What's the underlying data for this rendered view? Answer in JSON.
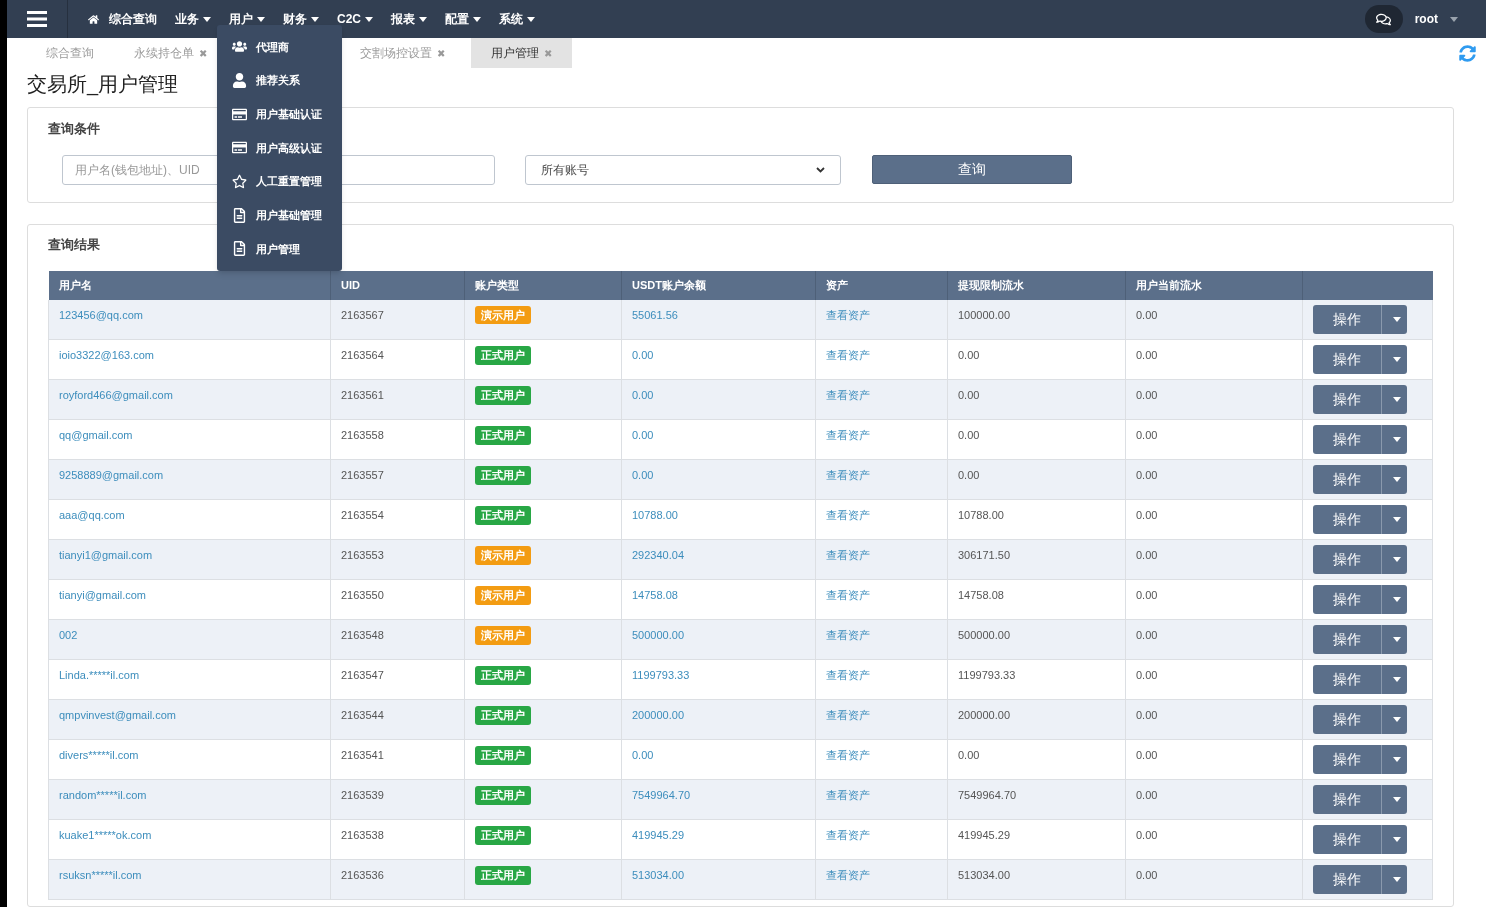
{
  "navbar": {
    "items": [
      {
        "label": "综合查询",
        "kind": "home"
      },
      {
        "label": "业务",
        "kind": "menu"
      },
      {
        "label": "用户",
        "kind": "menu"
      },
      {
        "label": "财务",
        "kind": "menu"
      },
      {
        "label": "C2C",
        "kind": "menu"
      },
      {
        "label": "报表",
        "kind": "menu"
      },
      {
        "label": "配置",
        "kind": "menu"
      },
      {
        "label": "系统",
        "kind": "menu"
      }
    ],
    "user": "root"
  },
  "dropdown": [
    {
      "label": "代理商",
      "kind": "group"
    },
    {
      "label": "推荐关系",
      "kind": "person"
    },
    {
      "label": "用户基础认证",
      "kind": "card"
    },
    {
      "label": "用户高级认证",
      "kind": "card"
    },
    {
      "label": "人工重置管理",
      "kind": "star"
    },
    {
      "label": "用户基础管理",
      "kind": "document"
    },
    {
      "label": "用户管理",
      "kind": "document"
    }
  ],
  "tabs": [
    {
      "label": "综合查询",
      "closable": false,
      "selected": false
    },
    {
      "label": "永续持仓单",
      "closable": true,
      "selected": false
    },
    {
      "label": "交割场控设置",
      "closable": true,
      "selected": false
    },
    {
      "label": "用户管理",
      "closable": true,
      "selected": true
    }
  ],
  "close_glyph": "✖",
  "page_title": "交易所_用户管理",
  "query_panel": {
    "title": "查询条件",
    "search": {
      "placeholder": "用户名(钱包地址)、UID"
    },
    "account_select": "所有账号",
    "button": "查询"
  },
  "results_panel": {
    "title": "查询结果"
  },
  "table": {
    "columns": [
      "用户名",
      "UID",
      "账户类型",
      "USDT账户余额",
      "资产",
      "提现限制流水",
      "用户当前流水"
    ],
    "rows": [
      {
        "username": "123456@qq.com",
        "uid": "2163567",
        "type": {
          "label": "演示用户",
          "kind": "demo"
        },
        "balance": "55061.56",
        "assets": "查看资产",
        "withdraw_limit": "100000.00",
        "current_flow": "0.00",
        "action": "操作"
      },
      {
        "username": "ioio3322@163.com",
        "uid": "2163564",
        "type": {
          "label": "正式用户",
          "kind": "real"
        },
        "balance": "0.00",
        "assets": "查看资产",
        "withdraw_limit": "0.00",
        "current_flow": "0.00",
        "action": "操作"
      },
      {
        "username": "royford466@gmail.com",
        "uid": "2163561",
        "type": {
          "label": "正式用户",
          "kind": "real"
        },
        "balance": "0.00",
        "assets": "查看资产",
        "withdraw_limit": "0.00",
        "current_flow": "0.00",
        "action": "操作"
      },
      {
        "username": "qq@gmail.com",
        "uid": "2163558",
        "type": {
          "label": "正式用户",
          "kind": "real"
        },
        "balance": "0.00",
        "assets": "查看资产",
        "withdraw_limit": "0.00",
        "current_flow": "0.00",
        "action": "操作"
      },
      {
        "username": "9258889@gmail.com",
        "uid": "2163557",
        "type": {
          "label": "正式用户",
          "kind": "real"
        },
        "balance": "0.00",
        "assets": "查看资产",
        "withdraw_limit": "0.00",
        "current_flow": "0.00",
        "action": "操作"
      },
      {
        "username": "aaa@qq.com",
        "uid": "2163554",
        "type": {
          "label": "正式用户",
          "kind": "real"
        },
        "balance": "10788.00",
        "assets": "查看资产",
        "withdraw_limit": "10788.00",
        "current_flow": "0.00",
        "action": "操作"
      },
      {
        "username": "tianyi1@gmail.com",
        "uid": "2163553",
        "type": {
          "label": "演示用户",
          "kind": "demo"
        },
        "balance": "292340.04",
        "assets": "查看资产",
        "withdraw_limit": "306171.50",
        "current_flow": "0.00",
        "action": "操作"
      },
      {
        "username": "tianyi@gmail.com",
        "uid": "2163550",
        "type": {
          "label": "演示用户",
          "kind": "demo"
        },
        "balance": "14758.08",
        "assets": "查看资产",
        "withdraw_limit": "14758.08",
        "current_flow": "0.00",
        "action": "操作"
      },
      {
        "username": "002",
        "uid": "2163548",
        "type": {
          "label": "演示用户",
          "kind": "demo"
        },
        "balance": "500000.00",
        "assets": "查看资产",
        "withdraw_limit": "500000.00",
        "current_flow": "0.00",
        "action": "操作"
      },
      {
        "username": "Linda.*****il.com",
        "uid": "2163547",
        "type": {
          "label": "正式用户",
          "kind": "real"
        },
        "balance": "1199793.33",
        "assets": "查看资产",
        "withdraw_limit": "1199793.33",
        "current_flow": "0.00",
        "action": "操作"
      },
      {
        "username": "qmpvinvest@gmail.com",
        "uid": "2163544",
        "type": {
          "label": "正式用户",
          "kind": "real"
        },
        "balance": "200000.00",
        "assets": "查看资产",
        "withdraw_limit": "200000.00",
        "current_flow": "0.00",
        "action": "操作"
      },
      {
        "username": "divers*****il.com",
        "uid": "2163541",
        "type": {
          "label": "正式用户",
          "kind": "real"
        },
        "balance": "0.00",
        "assets": "查看资产",
        "withdraw_limit": "0.00",
        "current_flow": "0.00",
        "action": "操作"
      },
      {
        "username": "random*****il.com",
        "uid": "2163539",
        "type": {
          "label": "正式用户",
          "kind": "real"
        },
        "balance": "7549964.70",
        "assets": "查看资产",
        "withdraw_limit": "7549964.70",
        "current_flow": "0.00",
        "action": "操作"
      },
      {
        "username": "kuake1*****ok.com",
        "uid": "2163538",
        "type": {
          "label": "正式用户",
          "kind": "real"
        },
        "balance": "419945.29",
        "assets": "查看资产",
        "withdraw_limit": "419945.29",
        "current_flow": "0.00",
        "action": "操作"
      },
      {
        "username": "rsuksn*****il.com",
        "uid": "2163536",
        "type": {
          "label": "正式用户",
          "kind": "real"
        },
        "balance": "513034.00",
        "assets": "查看资产",
        "withdraw_limit": "513034.00",
        "current_flow": "0.00",
        "action": "操作"
      }
    ]
  }
}
